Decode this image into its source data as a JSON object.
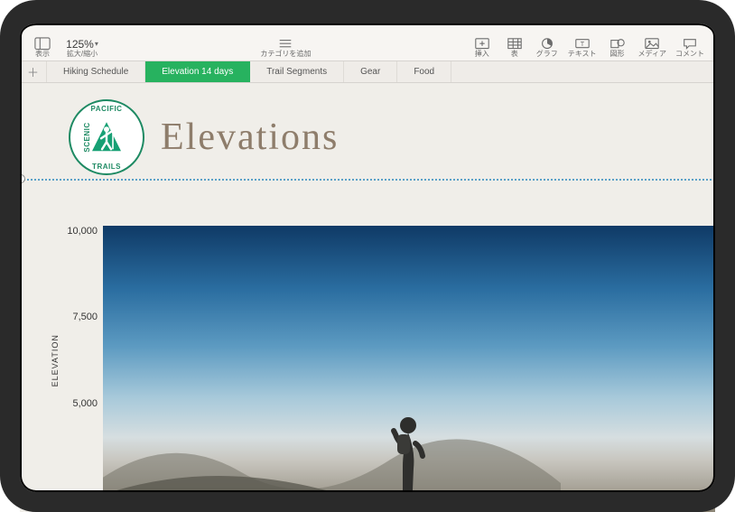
{
  "toolbar": {
    "left": {
      "view_label": "表示",
      "zoom_value": "125%",
      "zoom_label": "拡大/縮小"
    },
    "center": {
      "category_label": "カテゴリを追加"
    },
    "right": {
      "insert_label": "挿入",
      "table_label": "表",
      "chart_label": "グラフ",
      "text_label": "テキスト",
      "shape_label": "図形",
      "media_label": "メディア",
      "comment_label": "コメント"
    }
  },
  "sheets": {
    "items": [
      {
        "label": "Hiking Schedule",
        "active": false
      },
      {
        "label": "Elevation 14 days",
        "active": true
      },
      {
        "label": "Trail Segments",
        "active": false
      },
      {
        "label": "Gear",
        "active": false
      },
      {
        "label": "Food",
        "active": false
      }
    ]
  },
  "badge": {
    "top": "PACIFIC",
    "left": "SCENIC",
    "right": "",
    "bottom": "TRAILS"
  },
  "page": {
    "title": "Elevations"
  },
  "chart_data": {
    "type": "bar",
    "title": "Elevations",
    "ylabel": "ELEVATION",
    "ylim": [
      0,
      10000
    ],
    "y_ticks": [
      "10,000",
      "7,500",
      "5,000"
    ],
    "categories": [],
    "values": []
  }
}
